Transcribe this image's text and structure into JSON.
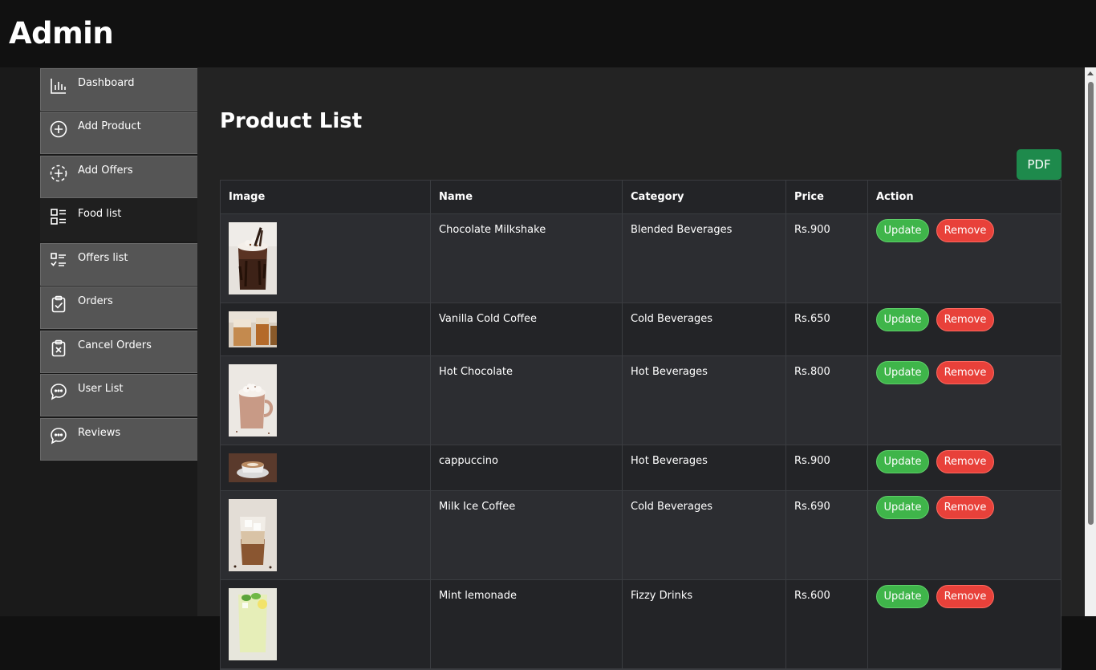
{
  "app": {
    "title": "Admin"
  },
  "sidebar": {
    "items": [
      {
        "label": "Dashboard",
        "icon": "bar-chart-icon",
        "active": false
      },
      {
        "label": "Add Product",
        "icon": "plus-circle-icon",
        "active": false
      },
      {
        "label": "Add Offers",
        "icon": "dashed-plus-circle-icon",
        "active": false
      },
      {
        "label": "Food list",
        "icon": "list-icon",
        "active": true
      },
      {
        "label": "Offers list",
        "icon": "checklist-icon",
        "active": false
      },
      {
        "label": "Orders",
        "icon": "clipboard-check-icon",
        "active": false
      },
      {
        "label": "Cancel Orders",
        "icon": "clipboard-x-icon",
        "active": false
      },
      {
        "label": "User List",
        "icon": "chat-bubble-icon",
        "active": false
      },
      {
        "label": "Reviews",
        "icon": "chat-bubble-icon",
        "active": false
      }
    ]
  },
  "main": {
    "title": "Product List",
    "pdf_label": "PDF",
    "columns": [
      "Image",
      "Name",
      "Category",
      "Price",
      "Action"
    ],
    "update_label": "Update",
    "remove_label": "Remove",
    "products": [
      {
        "name": "Chocolate Milkshake",
        "category": "Blended Beverages",
        "price": "Rs.900",
        "image": "chocolate-milkshake-photo"
      },
      {
        "name": "Vanilla Cold Coffee",
        "category": "Cold Beverages",
        "price": "Rs.650",
        "image": "vanilla-cold-coffee-photo"
      },
      {
        "name": "Hot Chocolate",
        "category": "Hot Beverages",
        "price": "Rs.800",
        "image": "hot-chocolate-photo"
      },
      {
        "name": "cappuccino",
        "category": "Hot Beverages",
        "price": "Rs.900",
        "image": "cappuccino-photo"
      },
      {
        "name": "Milk Ice Coffee",
        "category": "Cold Beverages",
        "price": "Rs.690",
        "image": "milk-ice-coffee-photo"
      },
      {
        "name": "Mint lemonade",
        "category": "Fizzy Drinks",
        "price": "Rs.600",
        "image": "mint-lemonade-photo"
      }
    ]
  },
  "colors": {
    "update": "#3fb54a",
    "remove": "#e8413a",
    "pdf": "#1e8a4c",
    "background": "#232323"
  }
}
